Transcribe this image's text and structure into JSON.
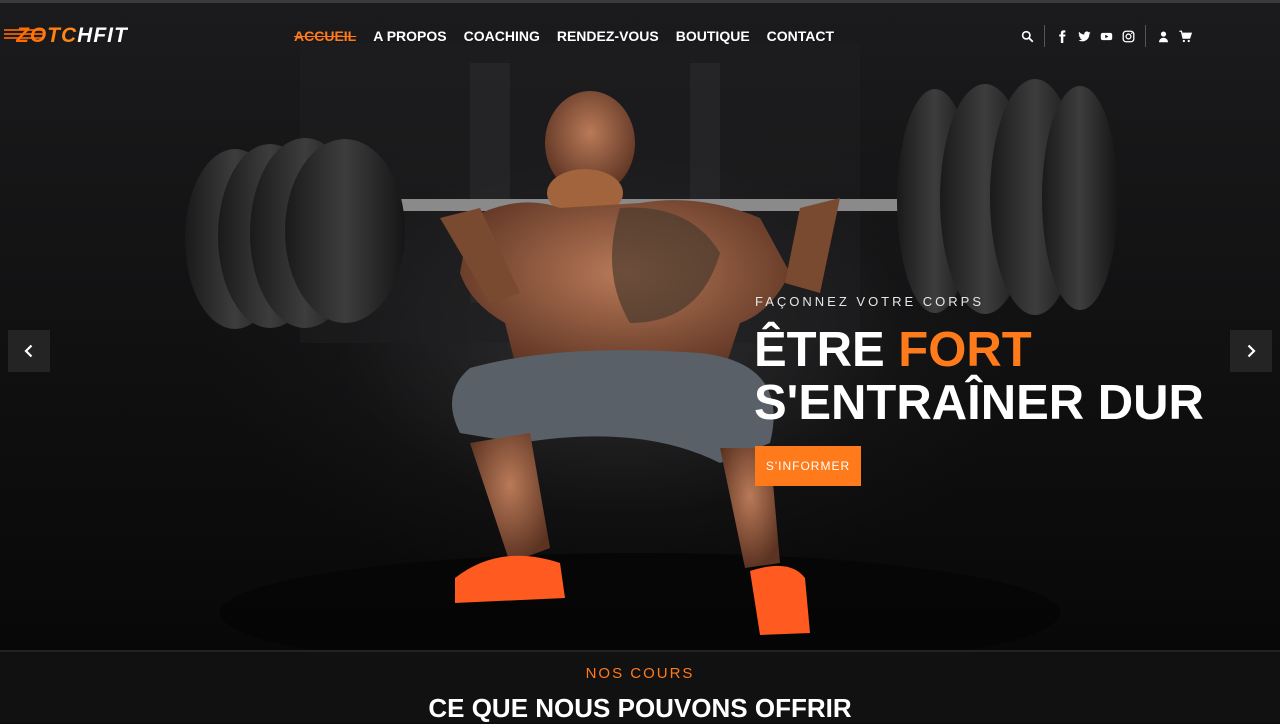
{
  "brand": {
    "logo_text": "ZOTCHFIT"
  },
  "nav": {
    "links": [
      "ACCUEIL",
      "A PROPOS",
      "COACHING",
      "RENDEZ-VOUS",
      "BOUTIQUE",
      "CONTACT"
    ],
    "active": "ACCUEIL"
  },
  "icons": [
    "search-icon",
    "facebook-icon",
    "twitter-icon",
    "youtube-icon",
    "instagram-icon",
    "user-icon",
    "cart-icon"
  ],
  "hero": {
    "subtitle": "FAÇONNEZ VOTRE CORPS",
    "headline_line1_pre": "ÊTRE ",
    "headline_line1_highlight": "FORT",
    "headline_line2": "S'ENTRAÎNER DUR",
    "cta": "S'INFORMER"
  },
  "section": {
    "kicker": "NOS COURS",
    "title": "CE QUE NOUS POUVONS OFFRIR"
  },
  "colors": {
    "accent": "#ff7a1a",
    "background": "#0d0d0d"
  }
}
